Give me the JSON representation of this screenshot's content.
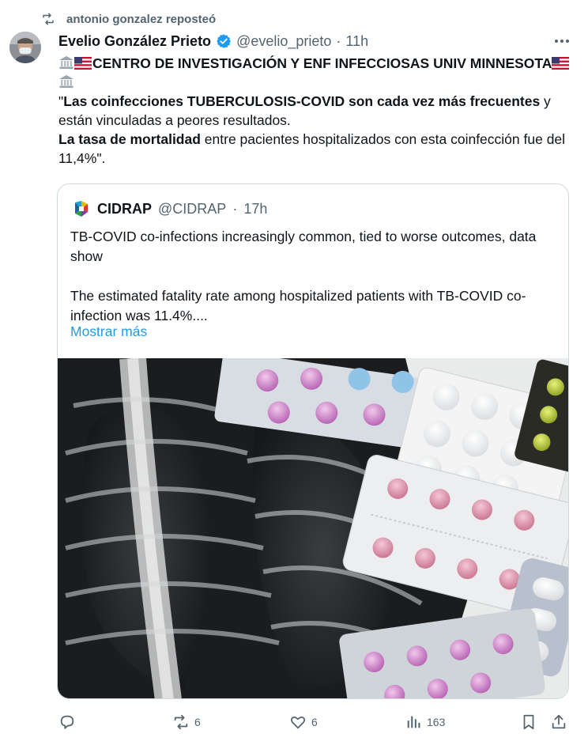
{
  "repost": {
    "label": "antonio gonzalez reposteó"
  },
  "tweet": {
    "author_name": "Evelio González Prieto",
    "handle": "@evelio_prieto",
    "separator": "·",
    "time": "11h",
    "line1": "CENTRO DE INVESTIGACIÓN Y ENF INFECCIOSAS UNIV MINNESOTA",
    "quote_open": "\"",
    "bold1": "Las coinfecciones TUBERCULOSIS-COVID son cada vez más frecuentes",
    "rest1": " y están vinculadas a peores resultados.",
    "bold2": "La tasa de mortalidad",
    "rest2": " entre pacientes hospitalizados con esta coinfección fue del 11,4%\"."
  },
  "quote": {
    "name": "CIDRAP",
    "handle": "@CIDRAP",
    "separator": "·",
    "time": "17h",
    "para1": "TB-COVID co-infections increasingly common, tied to worse outcomes, data show",
    "para2": "The estimated fatality rate among hospitalized patients with TB-COVID co-infection was 11.4%....",
    "show_more": "Mostrar más"
  },
  "actions": {
    "replies": "",
    "reposts": "6",
    "likes": "6",
    "views": "163"
  },
  "colors": {
    "text": "#0f1419",
    "secondary": "#536471",
    "link": "#1d9bf0",
    "verified": "#1d9bf0",
    "border": "#cfd9de"
  },
  "icons": [
    "repost-icon",
    "avatar",
    "verified-badge-icon",
    "more-icon",
    "bank-icon",
    "us-flag-icon",
    "cidrap-logo",
    "reply-icon",
    "retweet-icon",
    "like-icon",
    "views-icon",
    "bookmark-icon",
    "share-icon"
  ]
}
